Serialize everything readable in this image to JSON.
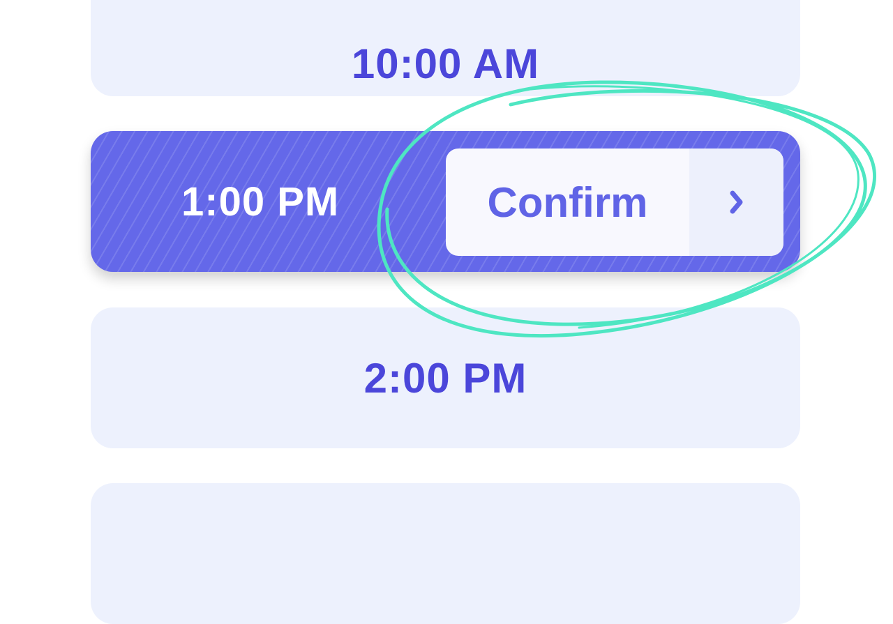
{
  "time_slots": [
    {
      "label": "10:00 AM",
      "selected": false
    },
    {
      "label": "1:00 PM",
      "selected": true
    },
    {
      "label": "2:00 PM",
      "selected": false
    },
    {
      "label": "",
      "selected": false
    }
  ],
  "confirm_button": {
    "label": "Confirm",
    "icon": "chevron-right-icon"
  },
  "colors": {
    "accent": "#6468E9",
    "slot_bg": "#EDF1FD",
    "slot_text": "#4B46DA",
    "annotation": "#4EE6C2"
  }
}
